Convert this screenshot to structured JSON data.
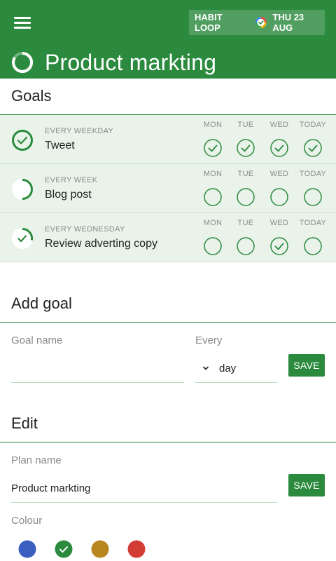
{
  "header": {
    "app_name": "HABIT LOOP",
    "date": "THU 23 AUG",
    "plan_title": "Product markting",
    "icons": {
      "menu": "hamburger-menu-icon",
      "clock": "clock-icon",
      "progress": "progress-ring-icon"
    },
    "colors": {
      "bar": "#2b8a3e",
      "text": "#ffffff"
    }
  },
  "goals_section": {
    "heading": "Goals",
    "day_labels": [
      "MON",
      "TUE",
      "WED",
      "TODAY"
    ],
    "items": [
      {
        "frequency": "EVERY WEEKDAY",
        "name": "Tweet",
        "progress": 1.0,
        "done": [
          true,
          true,
          true,
          true
        ]
      },
      {
        "frequency": "EVERY WEEK",
        "name": "Blog post",
        "progress": 0.5,
        "done": [
          false,
          false,
          false,
          false
        ]
      },
      {
        "frequency": "EVERY WEDNESDAY",
        "name": "Review adverting copy",
        "progress": 0.35,
        "done": [
          false,
          false,
          true,
          false
        ]
      }
    ]
  },
  "add_goal": {
    "heading": "Add goal",
    "name_label": "Goal name",
    "name_value": "",
    "every_label": "Every",
    "every_value": "day",
    "save_label": "SAVE"
  },
  "edit": {
    "heading": "Edit",
    "plan_label": "Plan name",
    "plan_value": "Product markting",
    "save_label": "SAVE",
    "colour_label": "Colour",
    "colours": [
      {
        "name": "blue",
        "hex": "#3b5fc0",
        "selected": false
      },
      {
        "name": "green",
        "hex": "#2b8a3e",
        "selected": true
      },
      {
        "name": "mustard",
        "hex": "#b8871e",
        "selected": false
      },
      {
        "name": "red",
        "hex": "#d33b35",
        "selected": false
      }
    ]
  }
}
